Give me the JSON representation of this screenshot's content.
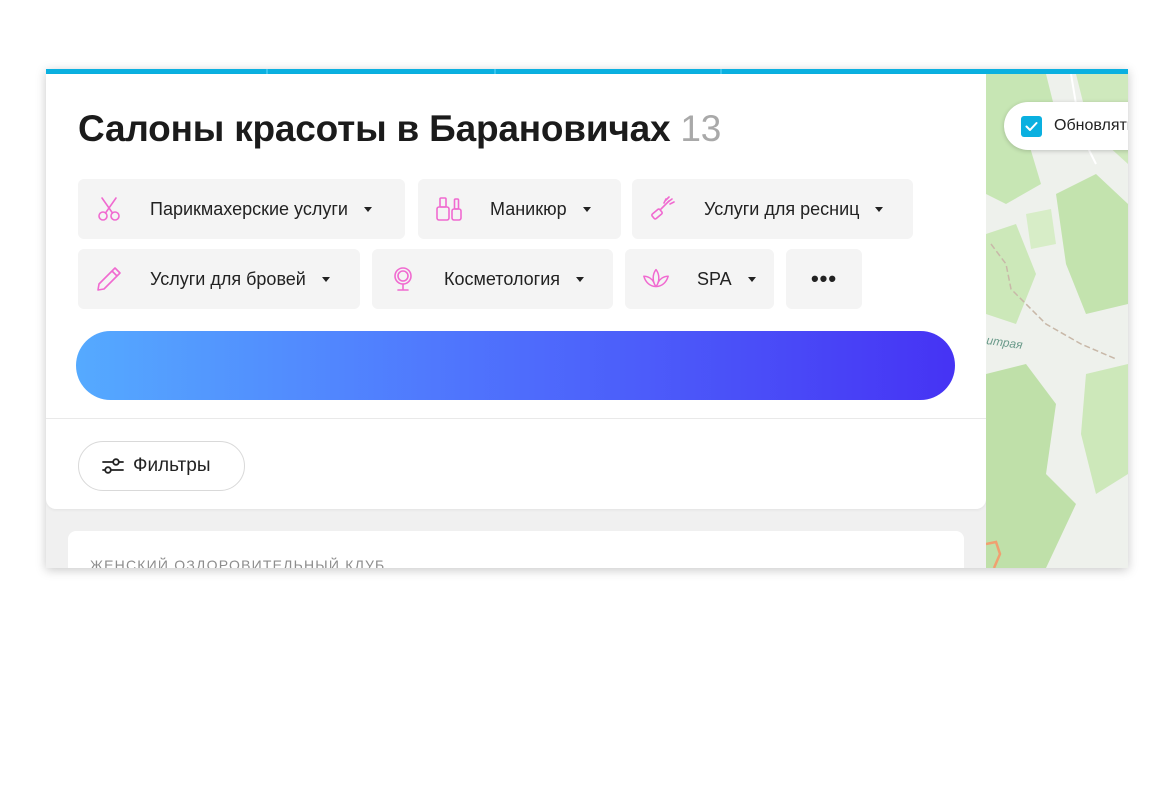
{
  "header": {
    "title": "Салоны красоты в Барановичах",
    "count": "13"
  },
  "categories": [
    {
      "label": "Парикмахерские услуги",
      "icon": "scissors-icon"
    },
    {
      "label": "Маникюр",
      "icon": "nail-polish-icon"
    },
    {
      "label": "Услуги для ресниц",
      "icon": "mascara-icon"
    },
    {
      "label": "Услуги для бровей",
      "icon": "brow-pencil-icon"
    },
    {
      "label": "Косметология",
      "icon": "mirror-icon"
    },
    {
      "label": "SPA",
      "icon": "lotus-icon"
    }
  ],
  "more_label": "•••",
  "filters": {
    "label": "Фильтры",
    "icon": "sliders-icon"
  },
  "card": {
    "category": "ЖЕНСКИЙ ОЗДОРОВИТЕЛЬНЫЙ КЛУБ"
  },
  "map": {
    "toggle_label": "Обновлять",
    "toggle_checked": true,
    "street_label": "итрая"
  },
  "colors": {
    "accent": "#0ab0e0",
    "icon_pink": "#f06ad0",
    "banner_start": "#55aaff",
    "banner_end": "#4633f4"
  }
}
